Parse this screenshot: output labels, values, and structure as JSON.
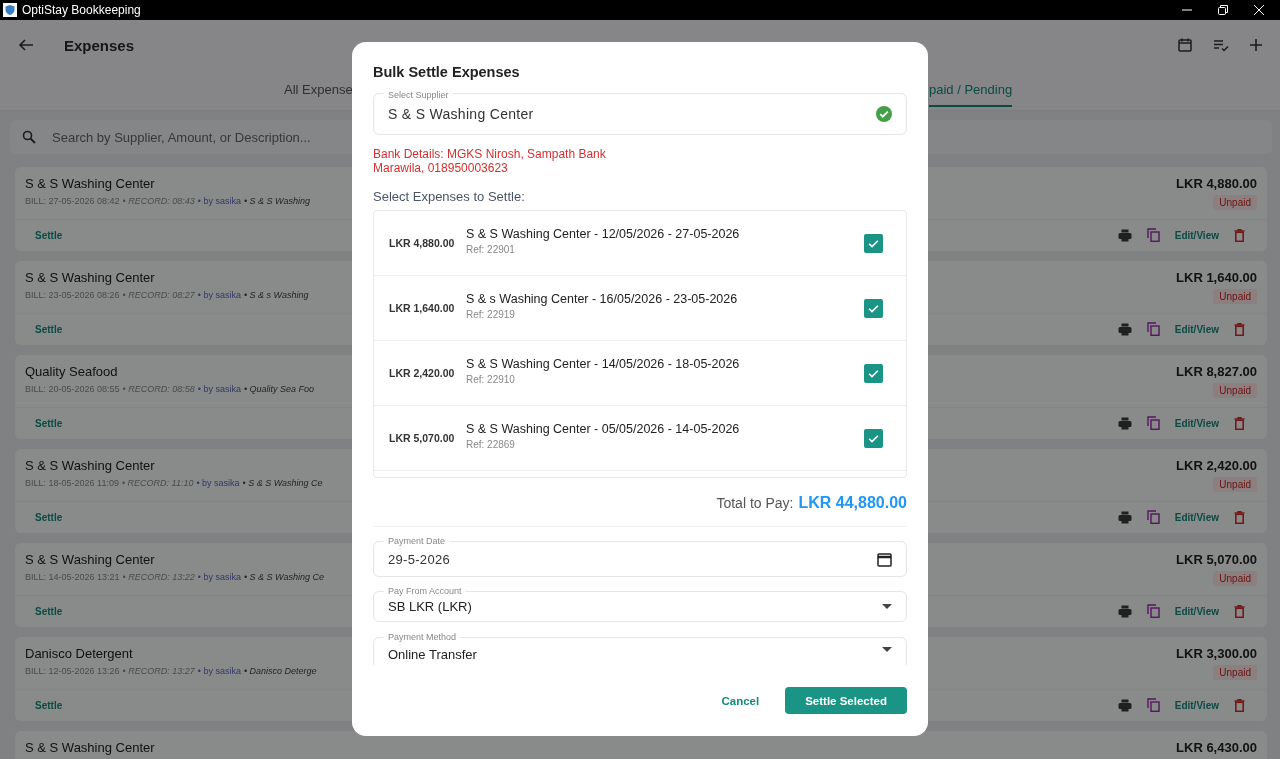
{
  "window": {
    "title": "OptiStay Bookkeeping"
  },
  "header": {
    "title": "Expenses"
  },
  "tabs": [
    {
      "label": "All Expense",
      "selected": false
    },
    {
      "label": "paid / Pending",
      "selected": true
    }
  ],
  "search": {
    "placeholder": "Search by Supplier, Amount, or Description..."
  },
  "expenses": [
    {
      "supplier": "S & S Washing Center",
      "bill": "BILL: 27-05-2026 08:42",
      "record": "• RECORD: 08:43",
      "user": "• by sasika",
      "description": "• S & S Washing",
      "amount": "LKR 4,880.00",
      "status": "Unpaid",
      "settle": "Settle",
      "edit": "Edit/View"
    },
    {
      "supplier": "S & S Washing Center",
      "bill": "BILL: 23-05-2026 08:26",
      "record": "• RECORD: 08:27",
      "user": "• by sasika",
      "description": "• S & s Washing",
      "amount": "LKR 1,640.00",
      "status": "Unpaid",
      "settle": "Settle",
      "edit": "Edit/View"
    },
    {
      "supplier": "Quality Seafood",
      "bill": "BILL: 20-05-2026 08:55",
      "record": "• RECORD: 08:58",
      "user": "• by sasika",
      "description": "• Quality Sea Foo",
      "amount": "LKR 8,827.00",
      "status": "Unpaid",
      "settle": "Settle",
      "edit": "Edit/View"
    },
    {
      "supplier": "S & S Washing Center",
      "bill": "BILL: 18-05-2026 11:09",
      "record": "• RECORD: 11:10",
      "user": "• by sasika",
      "description": "• S & S Washing Ce",
      "amount": "LKR 2,420.00",
      "status": "Unpaid",
      "settle": "Settle",
      "edit": "Edit/View"
    },
    {
      "supplier": "S & S Washing Center",
      "bill": "BILL: 14-05-2026 13:21",
      "record": "• RECORD: 13:22",
      "user": "• by sasika",
      "description": "• S & S Washing Ce",
      "amount": "LKR 5,070.00",
      "status": "Unpaid",
      "settle": "Settle",
      "edit": "Edit/View"
    },
    {
      "supplier": "Danisco Detergent",
      "bill": "BILL: 12-05-2026 13:26",
      "record": "• RECORD: 13:27",
      "user": "• by sasika",
      "description": "• Danisco Deterge",
      "amount": "LKR 3,300.00",
      "status": "Unpaid",
      "settle": "Settle",
      "edit": "Edit/View"
    },
    {
      "supplier": "S & S Washing Center",
      "amount": "LKR 6,430.00"
    }
  ],
  "modal": {
    "title": "Bulk Settle Expenses",
    "supplier_field": {
      "label": "Select Supplier",
      "value": "S & S Washing Center",
      "valid": true
    },
    "bank_details": [
      "Bank Details: MGKS Nirosh, Sampath Bank",
      "Marawila, 018950003623"
    ],
    "list_label": "Select Expenses to Settle:",
    "items": [
      {
        "amount": "LKR 4,880.00",
        "title": "S & S Washing Center - 12/05/2026 - 27-05-2026",
        "ref": "Ref: 22901",
        "checked": true
      },
      {
        "amount": "LKR 1,640.00",
        "title": "S & s Washing Center - 16/05/2026 - 23-05-2026",
        "ref": "Ref: 22919",
        "checked": true
      },
      {
        "amount": "LKR 2,420.00",
        "title": "S & S Washing Center - 14/05/2026 - 18-05-2026",
        "ref": "Ref: 22910",
        "checked": true
      },
      {
        "amount": "LKR 5,070.00",
        "title": "S & S Washing Center - 05/05/2026 - 14-05-2026",
        "ref": "Ref: 22869",
        "checked": true
      }
    ],
    "total_label": "Total to Pay:",
    "total_value": "LKR 44,880.00",
    "fields": [
      {
        "kind": "date",
        "label": "Payment Date",
        "value": "29-5-2026"
      },
      {
        "kind": "select",
        "label": "Pay From Account",
        "value": "SB LKR (LKR)"
      },
      {
        "kind": "select",
        "label": "Payment Method",
        "value": "Online Transfer"
      }
    ],
    "buttons": [
      {
        "kind": "text",
        "label": "Cancel"
      },
      {
        "kind": "primary",
        "label": "Settle Selected"
      }
    ]
  }
}
